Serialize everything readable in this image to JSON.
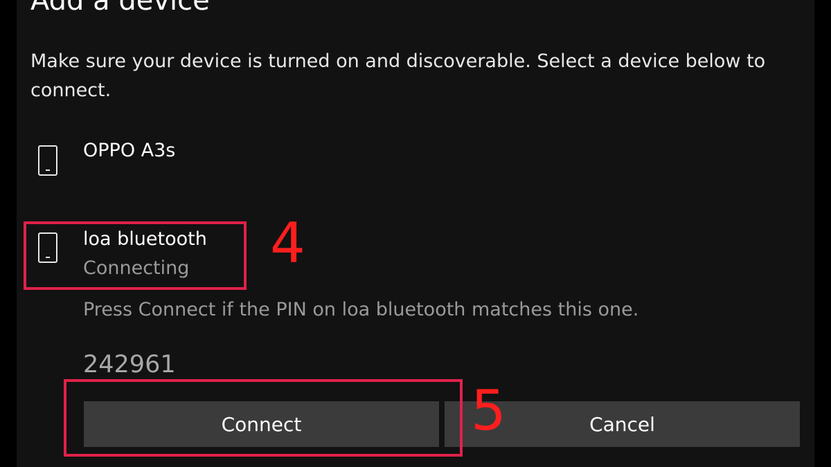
{
  "dialog": {
    "title": "Add a device",
    "instructions": "Make sure your device is turned on and discoverable. Select a device below to connect."
  },
  "devices": [
    {
      "name": "OPPO A3s",
      "icon": "phone-icon"
    },
    {
      "name": "loa bluetooth",
      "status": "Connecting",
      "icon": "phone-icon"
    }
  ],
  "pairing": {
    "prompt": "Press Connect if the PIN on loa bluetooth matches this one.",
    "pin": "242961"
  },
  "buttons": {
    "connect": "Connect",
    "cancel": "Cancel"
  },
  "annotations": {
    "step_device": "4",
    "step_connect": "5",
    "highlight_color": "#e0214a",
    "step_color": "#ff1e1e"
  }
}
